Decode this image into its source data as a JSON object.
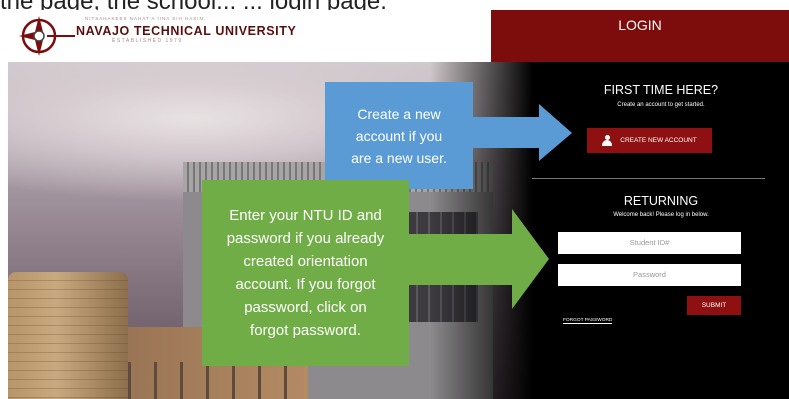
{
  "top_caption": "the page, the school...   ... login page.",
  "header": {
    "logo_text": "NAVAJO TECHNICAL UNIVERSITY",
    "logo_tagline": "ESTABLISHED 1979",
    "logo_top_words": "NITSAHAKEES  NAHAT'A  IINA  SIH HASIN",
    "login_label": "LOGIN"
  },
  "first_time": {
    "title": "FIRST TIME HERE?",
    "subtitle": "Create an account to get started.",
    "button_label": "CREATE NEW ACCOUNT"
  },
  "returning": {
    "title": "RETURNING",
    "subtitle": "Welcome back! Please log in below.",
    "student_id_placeholder": "Student ID#",
    "password_placeholder": "Password",
    "submit_label": "SUBMIT",
    "forgot_label": "FORGOT PASSWORD"
  },
  "callouts": {
    "blue": [
      "Create a new",
      "account if you",
      "are a new user."
    ],
    "green": [
      "Enter your NTU ID and",
      "password if you already",
      "created orientation",
      "account.  If you forgot",
      "password, click on",
      "forgot password."
    ]
  },
  "colors": {
    "brand_red": "#7d0c0c",
    "button_red": "#8f1010",
    "callout_blue": "#5b9bd5",
    "callout_green": "#70ad47"
  }
}
